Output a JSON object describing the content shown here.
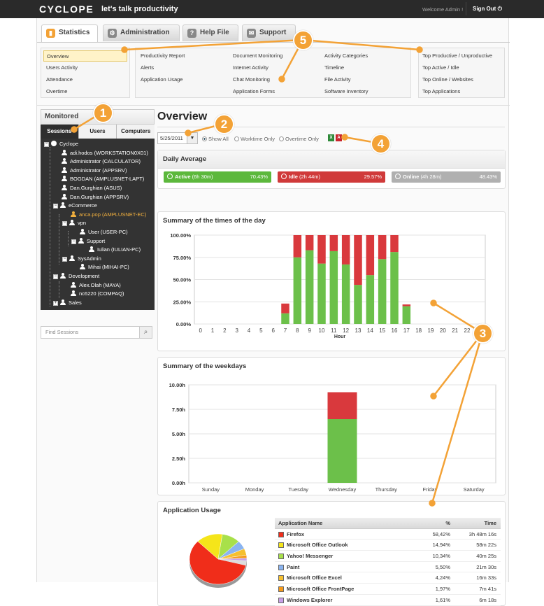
{
  "app": {
    "logo": "CYCLOPE",
    "slogan": "let's talk productivity",
    "welcome": "Welcome Admin !",
    "signout": "Sign Out"
  },
  "tabs": [
    {
      "label": "Statistics",
      "icon": "bar-chart-icon"
    },
    {
      "label": "Administration",
      "icon": "gear-icon"
    },
    {
      "label": "Help File",
      "icon": "help-icon"
    },
    {
      "label": "Support",
      "icon": "support-icon"
    }
  ],
  "menu": {
    "col1": [
      "Overview",
      "Users Activity",
      "Attendance",
      "Overtime"
    ],
    "col2": [
      "Productivity Report",
      "Alerts",
      "Application Usage"
    ],
    "col3": [
      "Document Monitoring",
      "Internet Activity",
      "Chat Monitoring",
      "Application Forms"
    ],
    "col4": [
      "Activity Categories",
      "Timeline",
      "File Activity",
      "Software Inventory"
    ],
    "col5": [
      "Top Productive / Unproductive",
      "Top Active / Idle",
      "Top Online / Websites",
      "Top Applications"
    ]
  },
  "sidebar": {
    "title": "Monitored",
    "tabs": [
      "Sessions",
      "Users",
      "Computers"
    ],
    "search_placeholder": "Find Sessions",
    "tree": [
      "Cyclope",
      "adi.hodos (WORKSTATION0X01)",
      "Administrator (CALCULATOR)",
      "Administrator (APPSRV)",
      "BOGDAN (AMPLUSNET-LAPT)",
      "Dan.Gurghian (ASUS)",
      "Dan.Gurghian (APPSRV)",
      "eCommerce",
      "anca.pop (AMPLUSNET-EC)",
      "vpn",
      "User (USER-PC)",
      "Support",
      "Iulian (IULIAN-PC)",
      "SysAdmin",
      "Mihai (MIHAI-PC)",
      "Development",
      "Alex.Olah (MAYA)",
      "nc6220 (COMPAQ)",
      "Sales"
    ]
  },
  "overview": {
    "title": "Overview",
    "date": "5/25/2011",
    "radios": [
      "Show All",
      "Worktime Only",
      "Overtime Only"
    ]
  },
  "daily": {
    "title": "Daily Average",
    "active": {
      "label": "Active",
      "dur": "(6h 30m)",
      "pct": "70.43%",
      "color": "#5cb83c"
    },
    "idle": {
      "label": "Idle",
      "dur": "(2h 44m)",
      "pct": "29.57%",
      "color": "#d03a3a"
    },
    "online": {
      "label": "Online",
      "dur": "(4h 28m)",
      "pct": "48.43%",
      "color": "#b0b0b0"
    }
  },
  "colors": {
    "active": "#6cc04a",
    "idle": "#d9393d",
    "accent": "#f3a236"
  },
  "callouts": [
    "1",
    "2",
    "3",
    "4",
    "5"
  ],
  "chart_data": [
    {
      "type": "bar",
      "title": "Summary of the times of the day",
      "xlabel": "Hour",
      "ylabel": "",
      "categories": [
        "0",
        "1",
        "2",
        "3",
        "4",
        "5",
        "6",
        "7",
        "8",
        "9",
        "10",
        "11",
        "12",
        "13",
        "14",
        "15",
        "16",
        "17",
        "18",
        "19",
        "20",
        "21",
        "22",
        "23"
      ],
      "yticks": [
        "100.00%",
        "75.00%",
        "50.00%",
        "25.00%",
        "0.00%"
      ],
      "ylim": [
        0,
        100
      ],
      "series": [
        {
          "values": [
            0,
            0,
            0,
            0,
            0,
            0,
            0,
            12,
            75,
            83,
            68,
            82,
            67,
            44,
            55,
            73,
            81,
            20,
            0,
            0,
            0,
            0,
            0,
            0
          ]
        },
        {
          "values": [
            0,
            0,
            0,
            0,
            0,
            0,
            0,
            11,
            25,
            17,
            32,
            18,
            33,
            56,
            45,
            27,
            19,
            2,
            0,
            0,
            0,
            0,
            0,
            0
          ]
        }
      ]
    },
    {
      "type": "bar",
      "title": "Summary of the weekdays",
      "xlabel": "",
      "ylabel": "",
      "categories": [
        "Sunday",
        "Monday",
        "Tuesday",
        "Wednesday",
        "Thursday",
        "Friday",
        "Saturday"
      ],
      "yticks": [
        "10.00h",
        "7.50h",
        "5.00h",
        "2.50h",
        "0.00h"
      ],
      "ylim": [
        0,
        10
      ],
      "series": [
        {
          "values": [
            0,
            0,
            0,
            6.5,
            0,
            0,
            0
          ]
        },
        {
          "values": [
            0,
            0,
            0,
            2.75,
            0,
            0,
            0
          ]
        }
      ]
    },
    {
      "type": "pie",
      "title": "Application Usage",
      "columns": [
        "Application Name",
        "%",
        "Time"
      ],
      "rows": [
        {
          "name": "Firefox",
          "pct": "58,42%",
          "time": "3h 48m 16s",
          "value": 58.42,
          "color": "#f02d1a"
        },
        {
          "name": "Microsoft Office Outlook",
          "pct": "14,94%",
          "time": "58m 22s",
          "value": 14.94,
          "color": "#f5e51a"
        },
        {
          "name": "Yahoo! Messenger",
          "pct": "10,34%",
          "time": "40m 25s",
          "value": 10.34,
          "color": "#a8e04a"
        },
        {
          "name": "Paint",
          "pct": "5,50%",
          "time": "21m 30s",
          "value": 5.5,
          "color": "#8ab4f0"
        },
        {
          "name": "Microsoft Office Excel",
          "pct": "4,24%",
          "time": "16m 33s",
          "value": 4.24,
          "color": "#f5c030"
        },
        {
          "name": "Microsoft Office FrontPage",
          "pct": "1,97%",
          "time": "7m 41s",
          "value": 1.97,
          "color": "#f59a1a"
        },
        {
          "name": "Windows Explorer",
          "pct": "1,61%",
          "time": "6m 18s",
          "value": 1.61,
          "color": "#c8a0e8"
        }
      ]
    }
  ]
}
